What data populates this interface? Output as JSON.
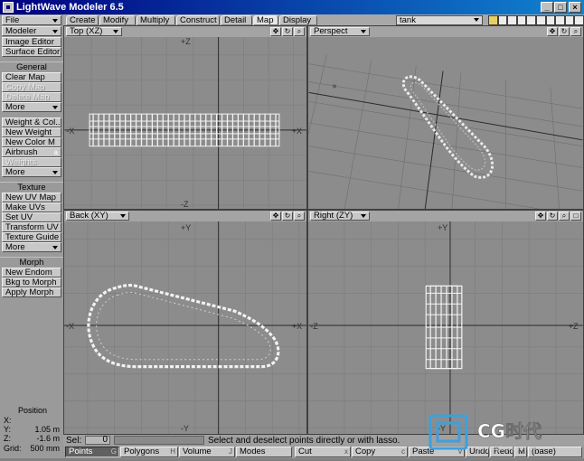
{
  "window": {
    "title": "LightWave Modeler 6.5",
    "buttons": [
      "_",
      "□",
      "×"
    ]
  },
  "left_panel": {
    "file": "File",
    "modeler": "Modeler",
    "items_top": [
      "Image Editor",
      "Surface Editor"
    ],
    "sections": [
      {
        "title": "General",
        "items": [
          {
            "label": "Clear Map",
            "disabled": false
          },
          {
            "label": "Copy Map",
            "disabled": true
          },
          {
            "label": "Delete Map",
            "disabled": true
          },
          {
            "label": "More",
            "disabled": false,
            "arrow": true
          }
        ]
      },
      {
        "title": "",
        "items": [
          {
            "label": "Weight & Col...",
            "disabled": false
          },
          {
            "label": "New Weight",
            "disabled": false
          },
          {
            "label": "New Color M",
            "disabled": false
          },
          {
            "label": "Airbrush",
            "disabled": false,
            "badge": "a"
          },
          {
            "label": "Weights",
            "disabled": true
          },
          {
            "label": "More",
            "disabled": false,
            "arrow": true
          }
        ]
      },
      {
        "title": "Texture",
        "items": [
          {
            "label": "New UV Map",
            "disabled": false
          },
          {
            "label": "Make UVs",
            "disabled": false
          },
          {
            "label": "Set UV",
            "disabled": false
          },
          {
            "label": "Transform UV",
            "disabled": false
          },
          {
            "label": "Texture Guide",
            "disabled": false
          },
          {
            "label": "More",
            "disabled": false,
            "arrow": true
          }
        ]
      },
      {
        "title": "Morph",
        "items": [
          {
            "label": "New Endom",
            "disabled": false
          },
          {
            "label": "Bkg to Morph",
            "disabled": false
          },
          {
            "label": "Apply Morph",
            "disabled": false
          }
        ]
      }
    ],
    "position": {
      "title": "Position",
      "x_label": "X:",
      "x": "",
      "y_label": "Y:",
      "y": "1.05 m",
      "z_label": "Z:",
      "z": "-1.6 m",
      "grid_label": "Grid:",
      "grid": "500 mm"
    }
  },
  "tabs": [
    {
      "label": "Create",
      "active": false
    },
    {
      "label": "Modify",
      "active": false
    },
    {
      "label": "Multiply",
      "active": false
    },
    {
      "label": "Construct",
      "active": false
    },
    {
      "label": "Detail",
      "active": false
    },
    {
      "label": "Map",
      "active": true
    },
    {
      "label": "Display",
      "active": false
    }
  ],
  "object_field": "tank",
  "viewports": {
    "top": {
      "view": "Top",
      "axes": "(XZ)",
      "labels": {
        "top": "+Z",
        "bottom": "-Z",
        "left": "-X",
        "right": "+X"
      }
    },
    "perspective": {
      "view": "Perspect"
    },
    "back": {
      "view": "Back",
      "axes": "(XY)",
      "labels": {
        "top": "+Y",
        "bottom": "-Y",
        "left": "-X",
        "right": "+X"
      }
    },
    "right": {
      "view": "Right",
      "axes": "(ZY)",
      "labels": {
        "top": "+Y",
        "bottom": "-Y",
        "left": "-Z",
        "right": "+Z"
      }
    }
  },
  "viewport_tool_icons": [
    "move-icon",
    "rotate-icon",
    "zoom-icon",
    "maximize-icon"
  ],
  "status": {
    "sel_label": "Sel:",
    "sel_count": "0",
    "message": "Select and deselect points directly or with lasso."
  },
  "bottom_toolbar": {
    "points": "Points",
    "points_key": "G",
    "polygons": "Polygons",
    "polygons_key": "H",
    "volume": "Volume",
    "volume_key": "J",
    "modes": "Modes",
    "cut": "Cut",
    "cut_key": "x",
    "copy": "Copy",
    "copy_key": "c",
    "paste": "Paste",
    "paste_key": "v",
    "undo": "Undo",
    "redo": "Redo",
    "m_label": "M",
    "surface": "(base)"
  },
  "watermark": {
    "text": "CG时代",
    "url": "www.cgtimes.com.cn"
  },
  "colors": {
    "wire": "#f4f4f4",
    "grid": "#7c7c7c",
    "axis": "#2a2a2a",
    "title": "#000080",
    "accent_layer": "#e8d060"
  }
}
